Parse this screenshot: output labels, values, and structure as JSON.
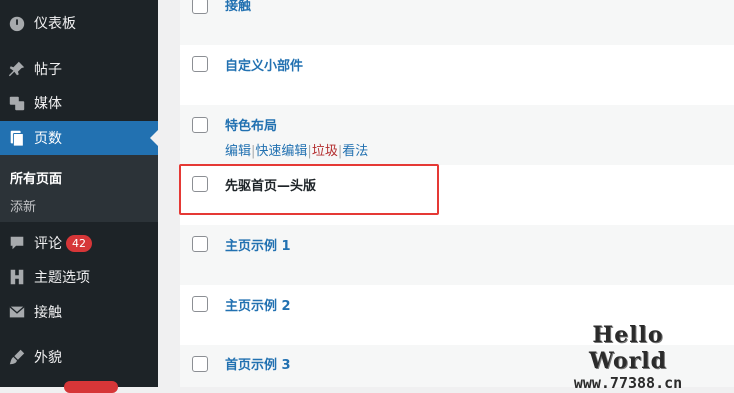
{
  "sidebar": {
    "items": [
      {
        "label": "仪表板",
        "icon": "dashboard-icon"
      },
      {
        "label": "帖子",
        "icon": "pin-icon"
      },
      {
        "label": "媒体",
        "icon": "media-icon"
      },
      {
        "label": "页数",
        "icon": "pages-icon",
        "active": true
      },
      {
        "label": "评论",
        "icon": "comment-icon",
        "badge": "42"
      },
      {
        "label": "主题选项",
        "icon": "theme-options-icon"
      },
      {
        "label": "接触",
        "icon": "mail-icon"
      },
      {
        "label": "外貌",
        "icon": "brush-icon"
      }
    ],
    "submenu": {
      "current": "所有页面",
      "add": "添新"
    }
  },
  "pages": [
    {
      "title": "接触"
    },
    {
      "title": "自定义小部件"
    },
    {
      "title": "特色布局",
      "actions": [
        "编辑",
        "快速编辑",
        "垃圾",
        "看法"
      ]
    },
    {
      "title": "先驱首页—头版"
    },
    {
      "title": "主页示例 1"
    },
    {
      "title": "主页示例 2"
    },
    {
      "title": "首页示例 3"
    }
  ],
  "watermark": {
    "line1": "Hello World",
    "line2": "www.77388.cn"
  },
  "colors": {
    "sidebar_bg": "#1d2327",
    "accent": "#2271b1",
    "badge": "#d63638",
    "highlight_box": "#e53935"
  }
}
